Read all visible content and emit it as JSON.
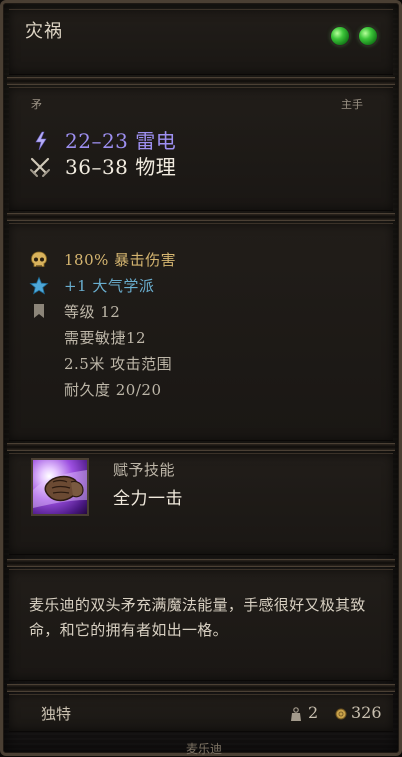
{
  "header": {
    "title": "灾祸"
  },
  "gems": [
    {
      "color": "#3dc63a",
      "icon": "green-gem-icon"
    },
    {
      "color": "#3dc63a",
      "icon": "green-gem-icon"
    }
  ],
  "weapon": {
    "type_label": "矛",
    "slot_label": "主手"
  },
  "damage": [
    {
      "icon": "lightning-icon",
      "text": "22–23 雷电",
      "color": "#9d8ff0"
    },
    {
      "icon": "crossed-swords-icon",
      "text": "36–38 物理",
      "color": "#f2ece0"
    }
  ],
  "properties": [
    {
      "icon": "skull-icon",
      "text": "180% 暴击伤害"
    },
    {
      "icon": "star-icon",
      "text": "+1 大气学派"
    },
    {
      "icon": "bookmark-icon",
      "text": "等级 12"
    },
    {
      "icon": "",
      "text": "需要敏捷12"
    },
    {
      "icon": "",
      "text": "2.5米 攻击范围"
    },
    {
      "icon": "",
      "text": "耐久度 20/20"
    }
  ],
  "skill": {
    "grant_label": "赋予技能",
    "name": "全力一击",
    "icon": "fist-skill-icon"
  },
  "description": "麦乐迪的双头矛充满魔法能量，手感很好又极其致命，和它的拥有者如出一格。",
  "footer": {
    "rarity": "独特",
    "weight": "2",
    "value": "326",
    "weight_icon": "weight-icon",
    "coin_icon": "coin-icon",
    "owner_name": "麦乐迪"
  }
}
